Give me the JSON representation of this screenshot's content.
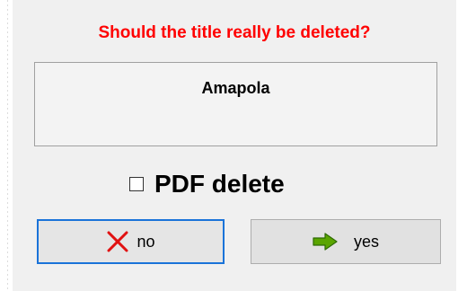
{
  "dialog": {
    "question": "Should the title really be deleted?",
    "title_value": "Amapola",
    "checkbox": {
      "label": "PDF delete",
      "checked": false
    },
    "buttons": {
      "no_label": "no",
      "no_icon": "red-x-icon",
      "yes_label": "yes",
      "yes_icon": "green-arrow-right-icon"
    }
  },
  "colors": {
    "question_text": "#ff0000",
    "focus_border": "#1a73d9",
    "no_icon": "#e11111",
    "yes_icon": "#5aa500"
  }
}
